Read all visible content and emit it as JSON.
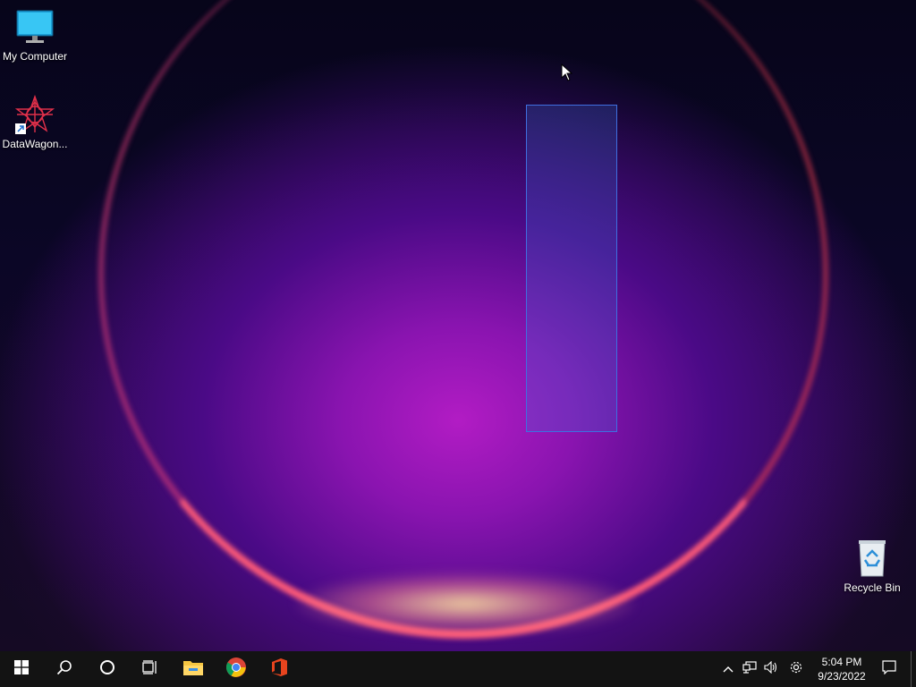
{
  "desktop": {
    "icons": [
      {
        "label": "My Computer",
        "icon": "monitor-icon"
      },
      {
        "label": "DataWagon...",
        "icon": "datawagon-shortcut-icon"
      },
      {
        "label": "Recycle Bin",
        "icon": "recycle-bin-icon"
      }
    ]
  },
  "taskbar": {
    "start": "windows-start-icon",
    "search": "search-icon",
    "cortana": "cortana-circle-icon",
    "task_view": "task-view-icon",
    "pinned": [
      "file-explorer-icon",
      "chrome-icon",
      "office-icon"
    ],
    "tray": {
      "overflow": "chevron-up-icon",
      "network": "network-icon",
      "volume": "volume-icon",
      "settings": "gear-icon",
      "time": "5:04 PM",
      "date": "9/23/2022",
      "notifications": "action-center-icon"
    }
  }
}
